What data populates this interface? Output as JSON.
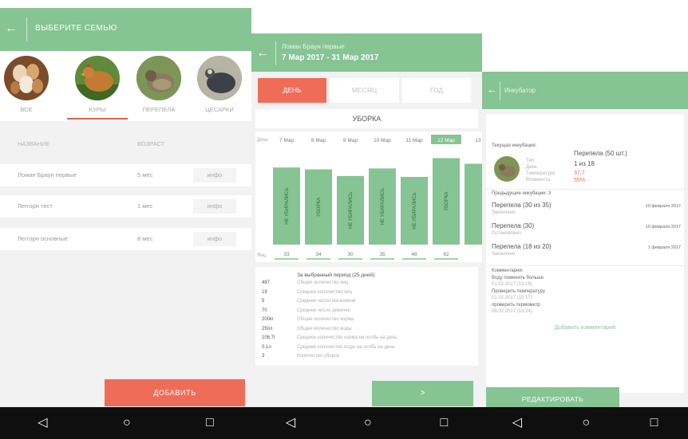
{
  "screen1": {
    "title": "ВЫБЕРИТЕ СЕМЬЮ",
    "families": [
      {
        "label": "ВСЕ",
        "icon": "eggs-photo"
      },
      {
        "label": "КУРЫ",
        "icon": "chicken-photo"
      },
      {
        "label": "ПЕРЕПЕЛА",
        "icon": "quail-photo"
      },
      {
        "label": "ЦЕСАРКИ",
        "icon": "guineafowl-photo"
      }
    ],
    "columns": {
      "name": "НАЗВАНИЕ",
      "age": "ВОЗРАСТ"
    },
    "rows": [
      {
        "name": "Ломан Браун первые",
        "age": "5 мес",
        "info": "инфо"
      },
      {
        "name": "Леггорн тест",
        "age": "1 мес",
        "info": "инфо"
      },
      {
        "name": "Леггорн основные",
        "age": "8 мес",
        "info": "инфо"
      }
    ],
    "add_button": "ДОБАВИТЬ"
  },
  "screen2": {
    "title_line1": "Ломан Браун первые",
    "title_line2": "7 Мар 2017 - 31 Мар 2017",
    "segments": {
      "day": "ДЕНЬ",
      "month": "МЕСЯЦ",
      "year": "ГОД"
    },
    "section": "УБОРКА",
    "chart_data": {
      "type": "bar",
      "x_label": "День",
      "y_label": "Яиц",
      "categories": [
        "7 Мар",
        "8 Мар",
        "9 Мар",
        "10 Мар",
        "11 Мар",
        "12 Мар",
        "13"
      ],
      "series": [
        {
          "values": [
            33,
            34,
            30,
            35,
            48,
            62,
            55
          ]
        }
      ],
      "bar_labels": [
        "НЕ УБИРАЛИСЬ",
        "УБОРКА",
        "НЕ УБИРАЛИСЬ",
        "НЕ УБИРАЛИСЬ",
        "НЕ УБИРАЛИСЬ",
        "УБОРКА",
        ""
      ],
      "value_labels": [
        "33",
        "34",
        "30",
        "35",
        "48",
        "62",
        ""
      ],
      "bar_heights_norm": [
        0.82,
        0.8,
        0.73,
        0.81,
        0.72,
        0.92,
        0.86
      ],
      "bar_color": "#86c493",
      "highlight_category": "12 Мар",
      "highlight_color": "#86c493"
    },
    "stats_title": "За выбранный период (25 дней):",
    "stats": [
      {
        "value": "487",
        "label": "Общее количество яиц"
      },
      {
        "value": "19",
        "label": "Среднее количество яиц"
      },
      {
        "value": "5",
        "label": "Среднее число мальчиков"
      },
      {
        "value": "70",
        "label": "Среднее число девочек"
      },
      {
        "value": "200кг",
        "label": "Общее количество корма"
      },
      {
        "value": "250л",
        "label": "Общее количество воды"
      },
      {
        "value": "106,7г",
        "label": "Среднее количество корма на особь на день"
      },
      {
        "value": "0,1л",
        "label": "Среднее количество воды на особь на день"
      },
      {
        "value": "3",
        "label": "Количество уборок"
      }
    ],
    "next_button": ">"
  },
  "screen3": {
    "title": "Инкубатор",
    "current_label": "Текущая инкубация:",
    "current": {
      "name": "Перепела (50 шт.)",
      "type_label": "Тип",
      "day_label": "День",
      "day_value": "1 из 18",
      "temp_label": "Температура",
      "temp_value": "37,7",
      "hum_label": "Влажность",
      "hum_value": "55%"
    },
    "previous_label": "Предыдущие инкубации: 3",
    "previous": [
      {
        "name": "Перепела (30 из 35)",
        "sub": "Закончено",
        "date": "10 февраля 2017"
      },
      {
        "name": "Перепела (30)",
        "sub": "Остановлено",
        "date": "10 февраля 2017"
      },
      {
        "name": "Перепела (18 из 20)",
        "sub": "Закончено",
        "date": "1 февраля 2017"
      }
    ],
    "comments_label": "Комментарии:",
    "comments": [
      {
        "text": "Воду поменять больше",
        "date": "01.02.2017 (13:19)"
      },
      {
        "text": "Проверить температуру",
        "date": "01.02.2017 (10:17)"
      },
      {
        "text": "проверить термометр",
        "date": "08.02.2017 (13:24)"
      }
    ],
    "add_comment": "Добавить комментарий",
    "edit_button": "РЕДАКТИРОВАТЬ"
  },
  "colors": {
    "accent_green": "#86c493",
    "accent_orange": "#ef6d58",
    "nav_bar": "#0f0f0f"
  }
}
